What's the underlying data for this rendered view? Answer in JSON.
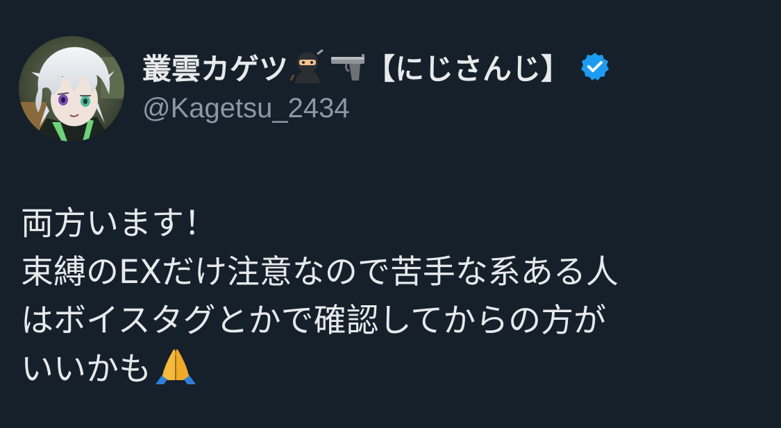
{
  "author": {
    "display_name": "叢雲カゲツ",
    "name_emojis": [
      "ninja-emoji",
      "pistol-emoji"
    ],
    "name_suffix": "【にじさんじ】",
    "handle": "@Kagetsu_2434",
    "verified": true,
    "verified_color": "#1d9bf0"
  },
  "tweet": {
    "lines": [
      "両方います！",
      "束縛のEXだけ注意なので苦手な系ある人",
      "はボイスタグとかで確認してからの方が",
      "いいかも"
    ],
    "trailing_emoji": "folded-hands-emoji"
  },
  "colors": {
    "background": "#15202b",
    "text": "#e7e9ea",
    "muted": "#8b98a5"
  }
}
